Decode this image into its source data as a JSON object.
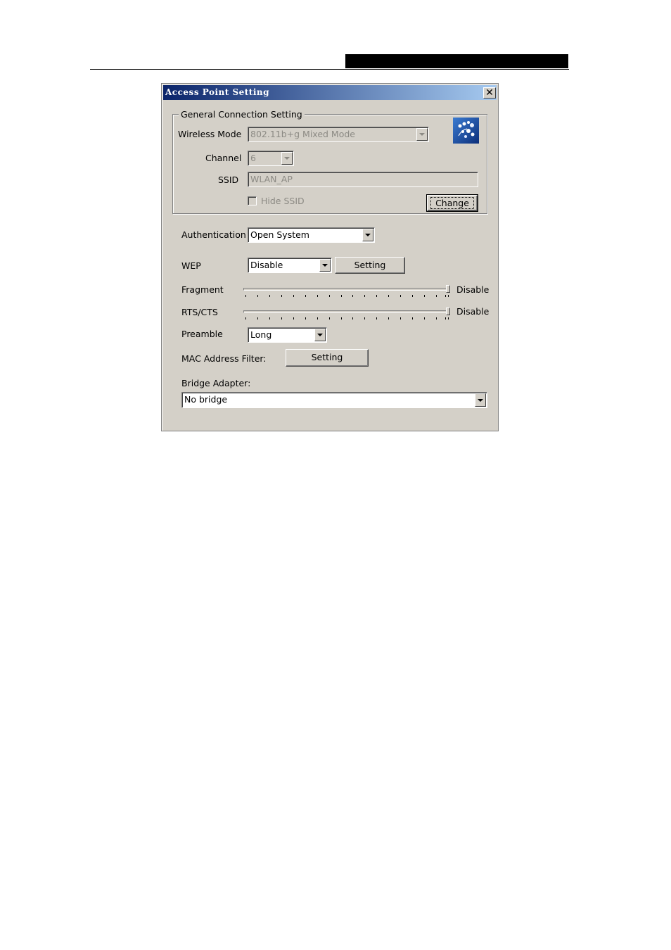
{
  "dialog": {
    "title": "Access Point Setting",
    "close_glyph": "✕"
  },
  "general": {
    "legend": "General Connection Setting",
    "wireless_mode_label": "Wireless Mode",
    "wireless_mode_value": "802.11b+g Mixed Mode",
    "channel_label": "Channel",
    "channel_value": "6",
    "ssid_label": "SSID",
    "ssid_value": "WLAN_AP",
    "hide_ssid_label": "Hide SSID",
    "hide_ssid_checked": false,
    "change_label": "Change",
    "icon": "wireless-network-icon"
  },
  "auth": {
    "label": "Authentication",
    "value": "Open System"
  },
  "wep": {
    "label": "WEP",
    "value": "Disable",
    "setting_label": "Setting"
  },
  "fragment": {
    "label": "Fragment",
    "status": "Disable",
    "position": 1.0
  },
  "rts": {
    "label": "RTS/CTS",
    "status": "Disable",
    "position": 1.0
  },
  "preamble": {
    "label": "Preamble",
    "value": "Long"
  },
  "mac_filter": {
    "label": "MAC Address Filter:",
    "setting_label": "Setting"
  },
  "bridge": {
    "label": "Bridge Adapter:",
    "value": "No bridge"
  },
  "colors": {
    "titlebar_start": "#0a246a",
    "titlebar_end": "#a6caf0",
    "dialog_bg": "#d4d0c8"
  }
}
